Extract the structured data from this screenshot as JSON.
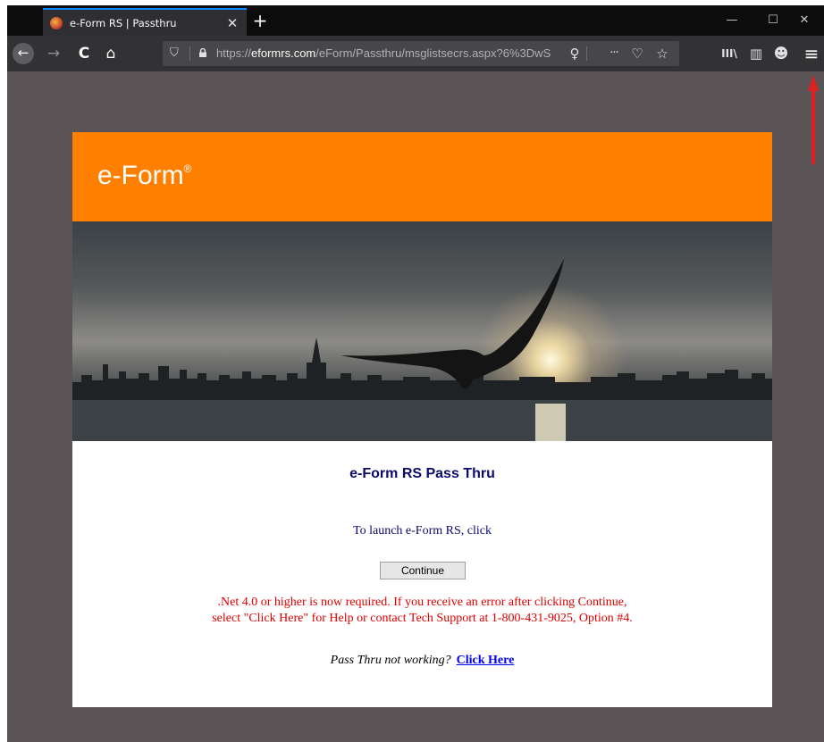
{
  "browser": {
    "tab": {
      "title": "e-Form RS | Passthru",
      "close": "✕"
    },
    "new_tab": "+",
    "window_controls": {
      "minimize": "—",
      "maximize": "☐",
      "close": "✕"
    },
    "url": {
      "prefix": "https://",
      "domain": "eformrs.com",
      "path": "/eForm/Passthru/msglistsecrs.aspx?6%3DwS"
    },
    "nav": {
      "back": "←",
      "forward": "→",
      "reload": "C",
      "home": "⌂"
    },
    "url_icons": {
      "shield": "⛉",
      "idea": "♀",
      "more": "···",
      "pocket": "♡",
      "star": "☆"
    },
    "toolbar_icons": {
      "library": "III\\",
      "sidebar": "▥",
      "account": "☻",
      "menu": "≡"
    }
  },
  "page": {
    "brand": "e-Form",
    "brand_mark": "®",
    "heading": "e-Form RS Pass Thru",
    "launch_text": "To launch e-Form RS, click",
    "continue_label": "Continue",
    "notice_line1": ".Net 4.0 or higher is now required. If you receive an error after clicking Continue,",
    "notice_line2": "select \"Click Here\" for Help or contact Tech Support at 1-800-431-9025, Option #4.",
    "help_text": "Pass Thru not working?",
    "help_link": "Click Here"
  },
  "colors": {
    "banner": "#ff8000",
    "heading": "#0b0b6b",
    "notice": "#e00000",
    "link": "#0000ee",
    "annotation_arrow": "#e02020"
  }
}
